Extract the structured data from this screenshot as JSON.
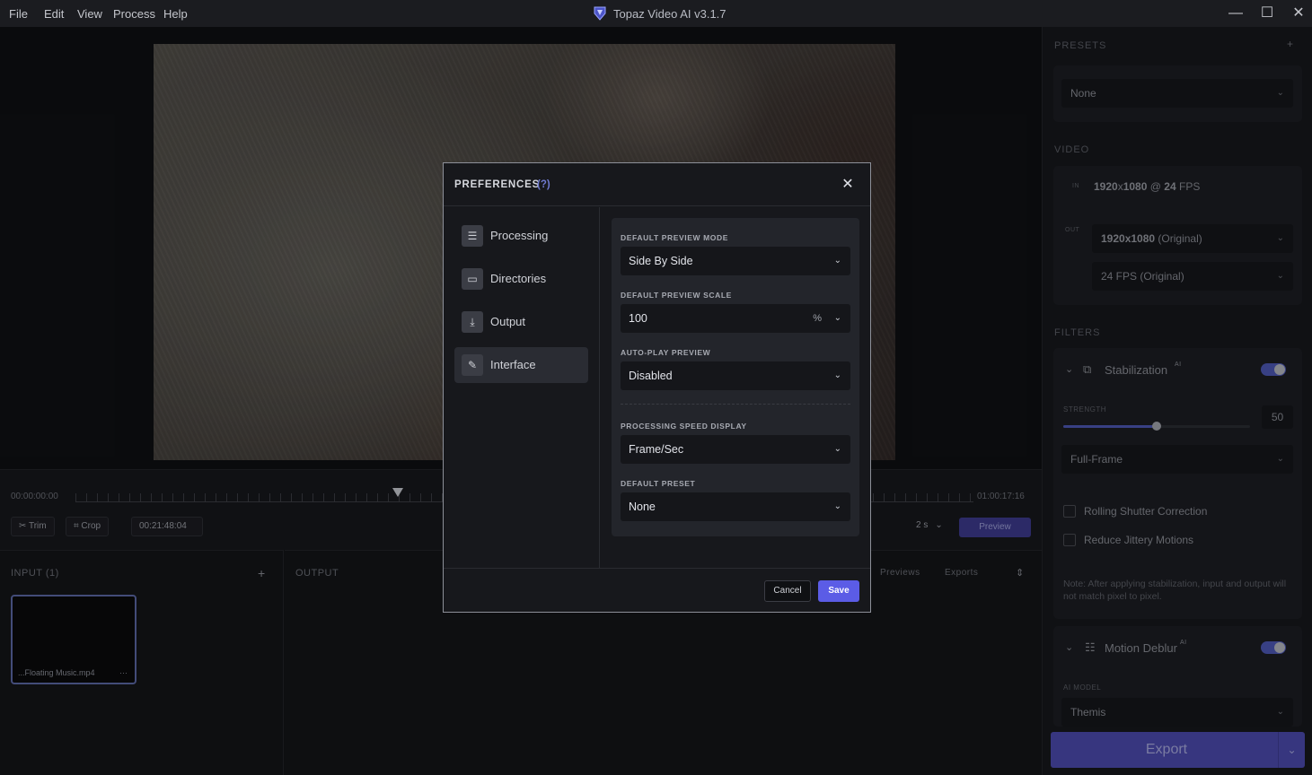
{
  "app": {
    "title": "Topaz Video AI  v3.1.7",
    "menu": [
      "File",
      "Edit",
      "View",
      "Process",
      "Help"
    ],
    "window_controls": {
      "minimize": "—",
      "maximize": "☐",
      "close": "✕"
    }
  },
  "timeline": {
    "start_time": "00:00:00:00",
    "end_time": "01:00:17:16",
    "trim_label": "Trim",
    "crop_label": "Crop",
    "current_time": "00:21:48:04",
    "interval": "2 s",
    "preview_label": "Preview"
  },
  "input_panel": {
    "label": "INPUT (1)",
    "add": "+",
    "file_name": "...Floating Music.mp4",
    "more": "···"
  },
  "output_panel": {
    "label": "OUTPUT",
    "tab_previews": "Previews",
    "tab_exports": "Exports",
    "sort": "⇕"
  },
  "sidebar": {
    "presets_label": "PRESETS",
    "presets_add": "+",
    "preset_value": "None",
    "video_label": "VIDEO",
    "in_tag": "IN",
    "in_res": "1920",
    "in_x": "x",
    "in_res2": "1080",
    "in_at": "@",
    "in_fps": "24",
    "in_fps_unit": "FPS",
    "out_tag": "OUT",
    "out_res": "1920x1080",
    "out_res_note": "(Original)",
    "out_fps": "24 FPS (Original)",
    "filters_label": "FILTERS",
    "stabilization": {
      "title": "Stabilization",
      "ai": "AI",
      "strength_label": "STRENGTH",
      "strength_value": "50",
      "strength_fraction": 0.5,
      "mode": "Full-Frame",
      "rolling_shutter": "Rolling Shutter Correction",
      "reduce_jittery": "Reduce Jittery Motions",
      "note": "Note: After applying stabilization, input and output will not match pixel to pixel."
    },
    "motion_deblur": {
      "title": "Motion Deblur",
      "ai": "AI",
      "model_label": "AI MODEL",
      "model_value": "Themis"
    },
    "export_label": "Export"
  },
  "dialog": {
    "title": "PREFERENCES",
    "help": "(?)",
    "close": "✕",
    "nav": [
      {
        "label": "Processing",
        "icon": "sliders-icon"
      },
      {
        "label": "Directories",
        "icon": "folder-icon"
      },
      {
        "label": "Output",
        "icon": "download-icon"
      },
      {
        "label": "Interface",
        "icon": "interface-icon"
      }
    ],
    "active_nav": "Interface",
    "fields": {
      "preview_mode_label": "DEFAULT PREVIEW MODE",
      "preview_mode_value": "Side By Side",
      "preview_scale_label": "DEFAULT PREVIEW SCALE",
      "preview_scale_value": "100",
      "preview_scale_unit": "%",
      "autoplay_label": "AUTO-PLAY PREVIEW",
      "autoplay_value": "Disabled",
      "speed_label": "PROCESSING SPEED DISPLAY",
      "speed_value": "Frame/Sec",
      "preset_label": "DEFAULT PRESET",
      "preset_value": "None"
    },
    "cancel_label": "Cancel",
    "save_label": "Save"
  },
  "colors": {
    "accent": "#5b5ce6",
    "toggle_on": "#4e59b8",
    "background": "#141518"
  }
}
